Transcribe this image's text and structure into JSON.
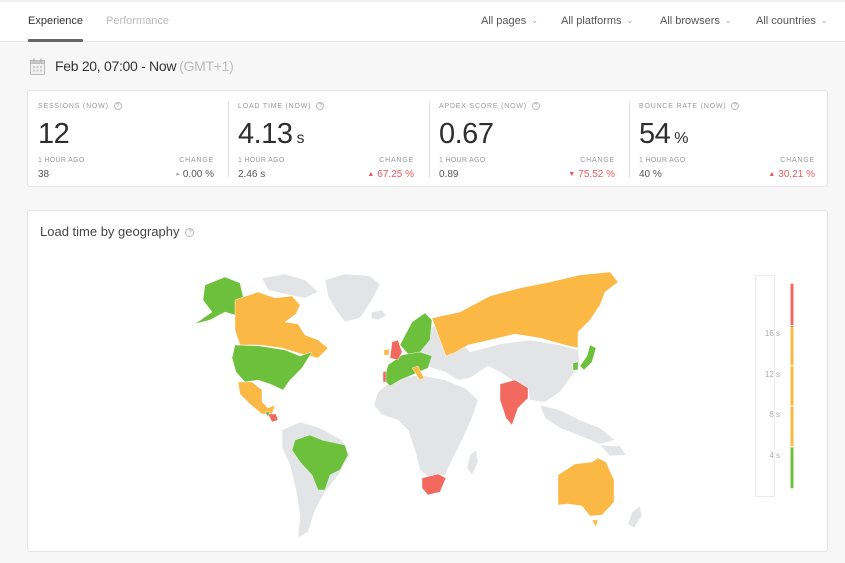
{
  "tabs": [
    {
      "label": "Experience",
      "active": true
    },
    {
      "label": "Performance",
      "active": false
    }
  ],
  "filters": [
    {
      "label": "All pages"
    },
    {
      "label": "All platforms"
    },
    {
      "label": "All browsers"
    },
    {
      "label": "All countries"
    }
  ],
  "date_range": {
    "icon": "calendar-icon",
    "main": "Feb 20, 07:00 - Now",
    "timezone": "(GMT+1)"
  },
  "metrics": [
    {
      "label": "SESSIONS (NOW)",
      "value": "12",
      "unit": "",
      "ago_label": "1 HOUR AGO",
      "ago_value": "38",
      "change_label": "CHANGE",
      "change_value": "0.00 %",
      "change_direction": "neutral",
      "change_arrow": "▸"
    },
    {
      "label": "LOAD TIME (NOW)",
      "value": "4.13",
      "unit": "s",
      "ago_label": "1 HOUR AGO",
      "ago_value": "2.46 s",
      "change_label": "CHANGE",
      "change_value": "67.25 %",
      "change_direction": "bad",
      "change_arrow": "▲"
    },
    {
      "label": "APDEX SCORE (NOW)",
      "value": "0.67",
      "unit": "",
      "ago_label": "1 HOUR AGO",
      "ago_value": "0.89",
      "change_label": "CHANGE",
      "change_value": "75.52 %",
      "change_direction": "bad",
      "change_arrow": "▼"
    },
    {
      "label": "BOUNCE RATE (NOW)",
      "value": "54",
      "unit": "%",
      "ago_label": "1 HOUR AGO",
      "ago_value": "40 %",
      "change_label": "CHANGE",
      "change_value": "30.21 %",
      "change_direction": "bad",
      "change_arrow": "▲"
    }
  ],
  "help_glyph": "?",
  "map": {
    "title": "Load time by geography",
    "colors": {
      "good": "#6cc03b",
      "medium": "#fbb844",
      "bad": "#f2695f",
      "no_data": "#e3e4e6"
    },
    "regions": [
      {
        "name": "Alaska (USA)",
        "level": "good"
      },
      {
        "name": "Canada",
        "level": "medium"
      },
      {
        "name": "United States",
        "level": "good"
      },
      {
        "name": "Mexico",
        "level": "medium"
      },
      {
        "name": "Central America",
        "level": "bad"
      },
      {
        "name": "Brazil",
        "level": "good"
      },
      {
        "name": "United Kingdom",
        "level": "bad"
      },
      {
        "name": "Ireland",
        "level": "medium"
      },
      {
        "name": "Portugal",
        "level": "bad"
      },
      {
        "name": "Western Europe",
        "level": "good"
      },
      {
        "name": "Scandinavia",
        "level": "good"
      },
      {
        "name": "Italy",
        "level": "medium"
      },
      {
        "name": "Russia",
        "level": "medium"
      },
      {
        "name": "Japan",
        "level": "good"
      },
      {
        "name": "South Korea",
        "level": "good"
      },
      {
        "name": "India",
        "level": "bad"
      },
      {
        "name": "South Africa",
        "level": "bad"
      },
      {
        "name": "Australia",
        "level": "medium"
      }
    ],
    "legend": {
      "ticks": [
        "16 s",
        "12 s",
        "8 s",
        "4 s"
      ],
      "tick_values": [
        16,
        12,
        8,
        4
      ],
      "range": [
        0,
        20
      ],
      "segments": [
        {
          "from": 0,
          "to": 4,
          "level": "good"
        },
        {
          "from": 4,
          "to": 16,
          "level": "medium"
        },
        {
          "from": 16,
          "to": 20,
          "level": "bad"
        }
      ]
    }
  }
}
